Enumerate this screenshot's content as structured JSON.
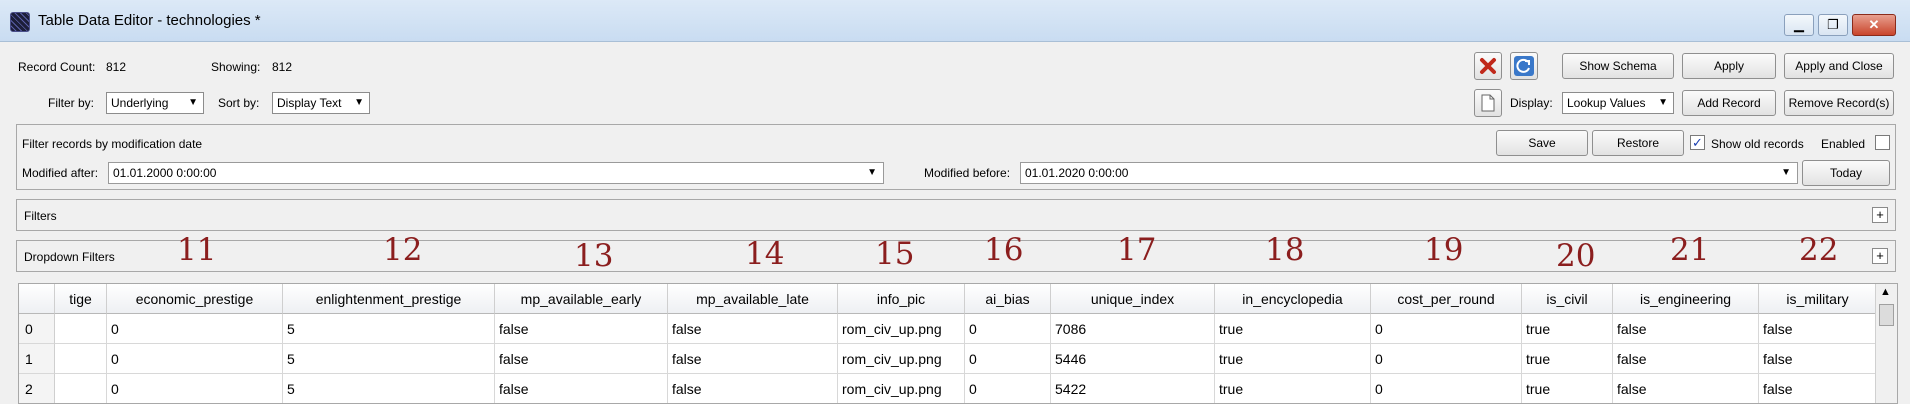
{
  "window": {
    "title": "Table Data Editor - technologies *",
    "min_glyph": "▁",
    "restore_glyph": "❐",
    "close_glyph": "✕"
  },
  "toolbar": {
    "record_count_label": "Record Count:",
    "record_count_value": "812",
    "showing_label": "Showing:",
    "showing_value": "812",
    "filter_by_label": "Filter by:",
    "filter_by_value": "Underlying",
    "sort_by_label": "Sort by:",
    "sort_by_value": "Display Text",
    "show_schema_label": "Show Schema",
    "apply_label": "Apply",
    "apply_close_label": "Apply and Close",
    "display_label": "Display:",
    "display_value": "Lookup Values",
    "add_record_label": "Add Record",
    "remove_record_label": "Remove Record(s)",
    "delete_icon": "red-x-icon",
    "refresh_icon": "refresh-icon",
    "page_icon": "document-icon"
  },
  "date_filter": {
    "title": "Filter records by modification date",
    "save_label": "Save",
    "restore_label": "Restore",
    "show_old_label": "Show old records",
    "show_old_checked": true,
    "enabled_label": "Enabled",
    "enabled_checked": false,
    "modified_after_label": "Modified after:",
    "modified_after_value": "01.01.2000 0:00:00",
    "modified_before_label": "Modified before:",
    "modified_before_value": "01.01.2020 0:00:00",
    "today_label": "Today"
  },
  "filters": {
    "filters_label": "Filters",
    "dropdown_filters_label": "Dropdown Filters",
    "expand_glyph": "+"
  },
  "column_numbers": [
    "11",
    "12",
    "13",
    "14",
    "15",
    "16",
    "17",
    "18",
    "19",
    "20",
    "21",
    "22"
  ],
  "table": {
    "columns": [
      "tige",
      "economic_prestige",
      "enlightenment_prestige",
      "mp_available_early",
      "mp_available_late",
      "info_pic",
      "ai_bias",
      "unique_index",
      "in_encyclopedia",
      "cost_per_round",
      "is_civil",
      "is_engineering",
      "is_military"
    ],
    "rows": [
      {
        "index": "0",
        "cells": [
          "",
          "0",
          "5",
          "false",
          "false",
          "rom_civ_up.png",
          "0",
          "7086",
          "true",
          "0",
          "true",
          "false",
          "false"
        ]
      },
      {
        "index": "1",
        "cells": [
          "",
          "0",
          "5",
          "false",
          "false",
          "rom_civ_up.png",
          "0",
          "5446",
          "true",
          "0",
          "true",
          "false",
          "false"
        ]
      },
      {
        "index": "2",
        "cells": [
          "",
          "0",
          "5",
          "false",
          "false",
          "rom_civ_up.png",
          "0",
          "5422",
          "true",
          "0",
          "true",
          "false",
          "false"
        ]
      }
    ],
    "scroll_up_glyph": "▲"
  }
}
